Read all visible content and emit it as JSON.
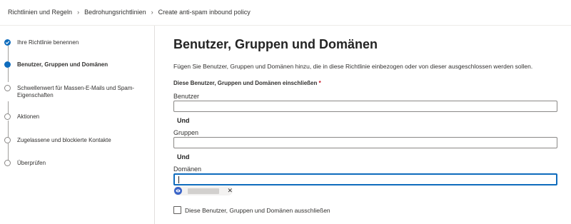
{
  "breadcrumb": {
    "items": [
      "Richtlinien und Regeln",
      "Bedrohungsrichtlinien",
      "Create anti-spam inbound policy"
    ]
  },
  "wizard": {
    "steps": [
      {
        "label": "Ihre Richtlinie benennen",
        "state": "completed"
      },
      {
        "label": "Benutzer, Gruppen und Domänen",
        "state": "current"
      },
      {
        "label": "Schwellenwert für Massen-E-Mails und Spam-Eigenschaften",
        "state": "pending"
      },
      {
        "label": "Aktionen",
        "state": "pending"
      },
      {
        "label": "Zugelassene und blockierte Kontakte",
        "state": "pending"
      },
      {
        "label": "Überprüfen",
        "state": "pending"
      }
    ]
  },
  "main": {
    "title": "Benutzer, Gruppen und Domänen",
    "description": "Fügen Sie Benutzer, Gruppen und Domänen hinzu, die in diese Richtlinie einbezogen oder von dieser ausgeschlossen werden sollen.",
    "include_section": {
      "label": "Diese Benutzer, Gruppen und Domänen einschließen",
      "required_marker": "*"
    },
    "users": {
      "label": "Benutzer",
      "value": ""
    },
    "and1": "Und",
    "groups": {
      "label": "Gruppen",
      "value": ""
    },
    "and2": "Und",
    "domains": {
      "label": "Domänen",
      "value": ""
    },
    "domain_chip": {
      "remove_symbol": "✕"
    },
    "exclude_checkbox": {
      "label": "Diese Benutzer, Gruppen und Domänen ausschließen",
      "checked": false
    }
  },
  "colors": {
    "accent": "#0f6cbd",
    "required": "#c50f1f",
    "chip_avatar": "#3a64c8"
  }
}
